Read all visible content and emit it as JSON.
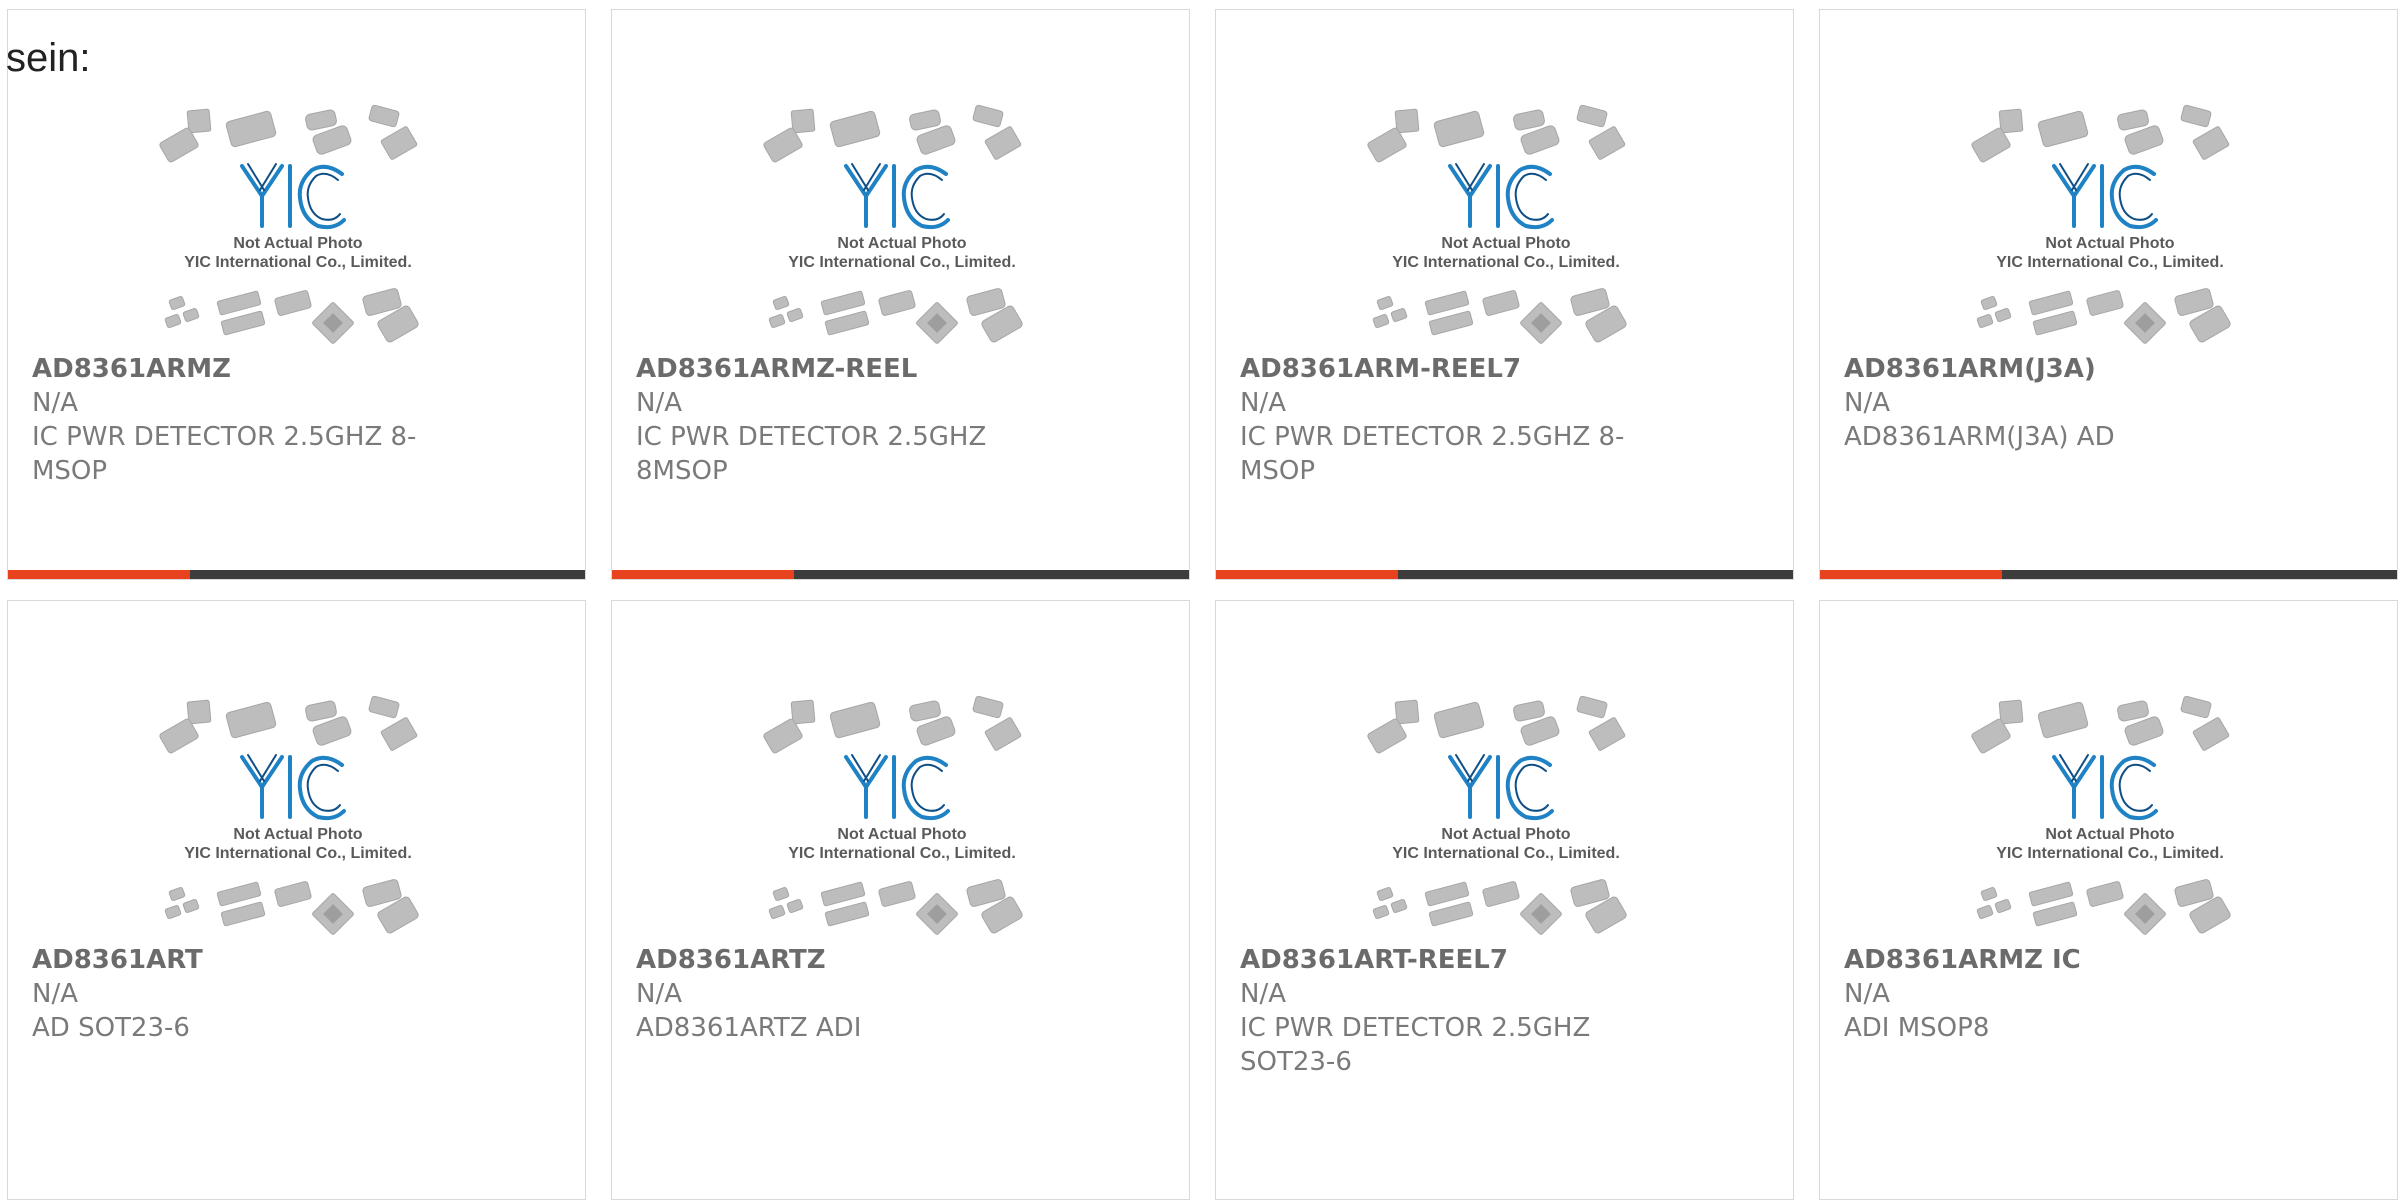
{
  "intro_text": "sein:",
  "photo": {
    "line1": "Not Actual Photo",
    "line2": "YIC International Co., Limited.",
    "logo_text": "YIC"
  },
  "colors": {
    "accent": "#e8431e",
    "bar": "#3d3d3d",
    "logo": "#1f82c4"
  },
  "products": [
    {
      "part": "AD8361ARMZ",
      "stock": "N/A",
      "desc": "IC PWR DETECTOR 2.5GHZ 8-MSOP"
    },
    {
      "part": "AD8361ARMZ-REEL",
      "stock": "N/A",
      "desc": "IC PWR DETECTOR 2.5GHZ 8MSOP"
    },
    {
      "part": "AD8361ARM-REEL7",
      "stock": "N/A",
      "desc": "IC PWR DETECTOR 2.5GHZ 8-MSOP"
    },
    {
      "part": "AD8361ARM(J3A)",
      "stock": "N/A",
      "desc": "AD8361ARM(J3A) AD"
    },
    {
      "part": "AD8361ART",
      "stock": "N/A",
      "desc": "AD SOT23-6"
    },
    {
      "part": "AD8361ARTZ",
      "stock": "N/A",
      "desc": "AD8361ARTZ ADI"
    },
    {
      "part": "AD8361ART-REEL7",
      "stock": "N/A",
      "desc": "IC PWR DETECTOR 2.5GHZ SOT23-6"
    },
    {
      "part": "AD8361ARMZ IC",
      "stock": "N/A",
      "desc": "ADI MSOP8"
    }
  ]
}
